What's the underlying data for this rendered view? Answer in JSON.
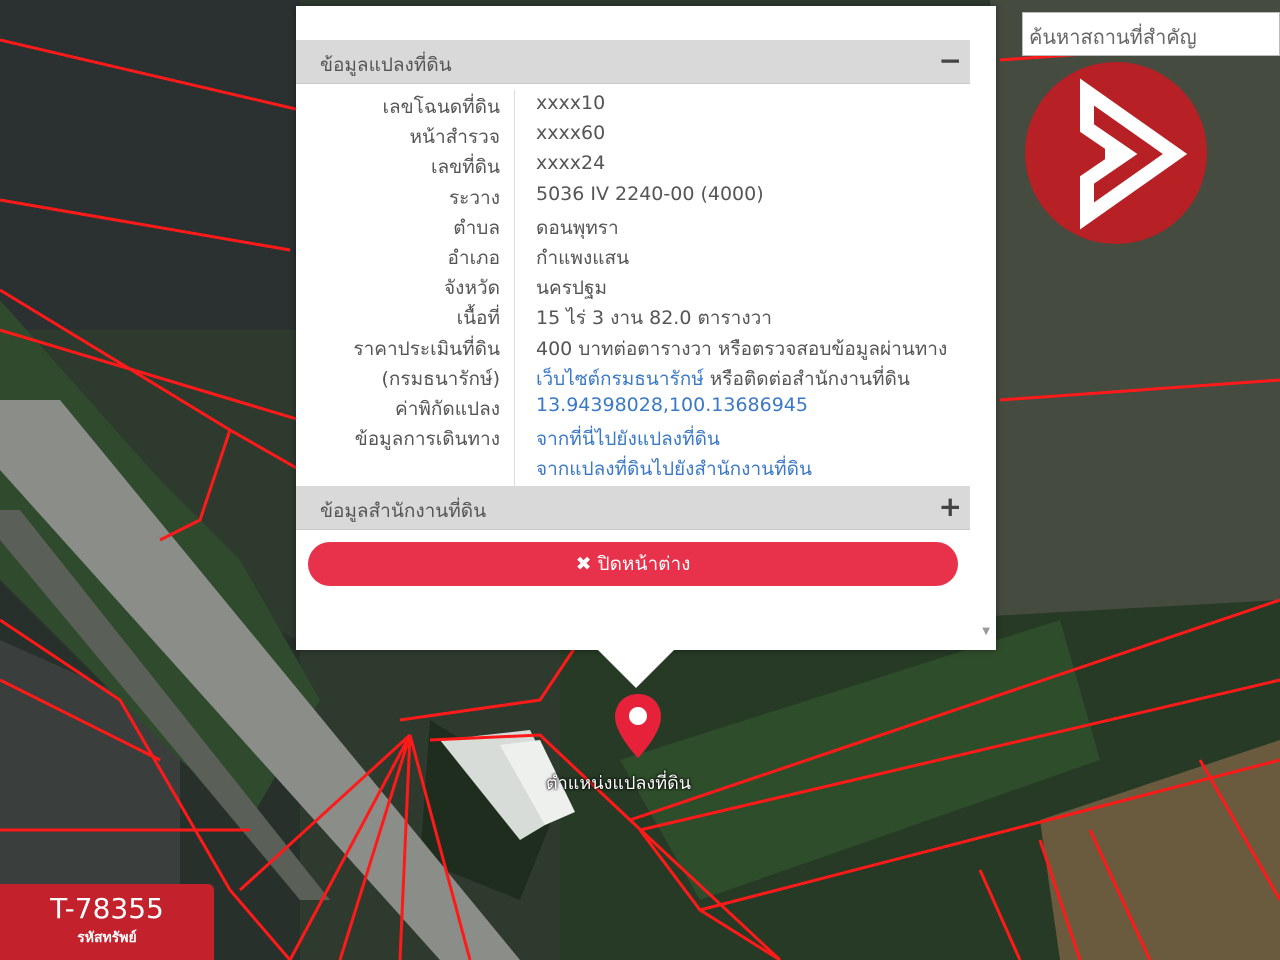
{
  "search": {
    "placeholder": "ค้นหาสถานที่สำคัญ"
  },
  "popup": {
    "section_land": {
      "title": "ข้อมูลแปลงที่ดิน",
      "toggle": "−"
    },
    "rows": [
      {
        "key": "เลขโฉนดที่ดิน",
        "value": "xxxx10"
      },
      {
        "key": "หน้าสำรวจ",
        "value": "xxxx60"
      },
      {
        "key": "เลขที่ดิน",
        "value": "xxxx24"
      },
      {
        "key": "ระวาง",
        "value": "5036 IV 2240-00 (4000)"
      },
      {
        "key": "ตำบล",
        "value": "ดอนพุทรา"
      },
      {
        "key": "อำเภอ",
        "value": "กำแพงแสน"
      },
      {
        "key": "จังหวัด",
        "value": "นครปฐม"
      },
      {
        "key": "เนื้อที่",
        "value": "15 ไร่ 3 งาน 82.0 ตารางวา"
      },
      {
        "key": "ราคาประเมินที่ดิน",
        "value": "400 บาทต่อตารางวา หรือตรวจสอบข้อมูลผ่านทาง"
      },
      {
        "key": "(กรมธนารักษ์)",
        "value_link": "เว็บไซต์กรมธนารักษ์",
        "value_plain": " หรือติดต่อสำนักงานที่ดิน"
      },
      {
        "key": "ค่าพิกัดแปลง",
        "value_link": "13.94398028,100.13686945"
      },
      {
        "key": "ข้อมูลการเดินทาง",
        "value_link": "จากที่นี่ไปยังแปลงที่ดิน"
      },
      {
        "key": "",
        "value_link": "จากแปลงที่ดินไปยังสำนักงานที่ดิน"
      }
    ],
    "section_office": {
      "title": "ข้อมูลสำนักงานที่ดิน",
      "toggle": "+"
    },
    "close_label": "✖ ปิดหน้าต่าง"
  },
  "marker": {
    "label": "ตำแหน่งแปลงที่ดิน",
    "color": "#e8213b"
  },
  "badge": {
    "code": "T-78355",
    "sub": "รหัสทรัพย์"
  },
  "colors": {
    "accent": "#e8314a",
    "brand": "#b72025",
    "parcel_line": "#ff1a1a",
    "link": "#3b79c6"
  }
}
